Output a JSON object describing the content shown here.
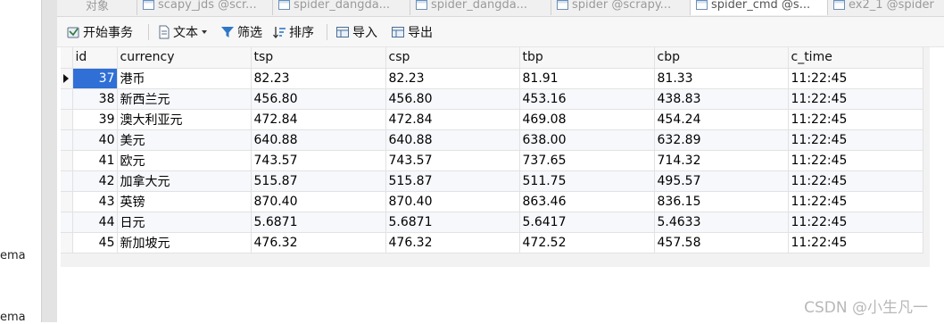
{
  "sidebar": {
    "fragments": [
      "ema",
      "ema"
    ]
  },
  "tabs": [
    {
      "label": "对象",
      "active": false
    },
    {
      "label": "scapy_jds @scr...",
      "active": false
    },
    {
      "label": "spider_dangda...",
      "active": false
    },
    {
      "label": "spider_dangda...",
      "active": false
    },
    {
      "label": "spider @scrapy...",
      "active": false
    },
    {
      "label": "spider_cmd @s...",
      "active": true
    },
    {
      "label": "ex2_1 @spider",
      "active": false
    }
  ],
  "toolbar": {
    "begin_transaction": "开始事务",
    "text": "文本",
    "filter": "筛选",
    "sort": "排序",
    "import": "导入",
    "export": "导出"
  },
  "grid": {
    "columns": [
      "id",
      "currency",
      "tsp",
      "csp",
      "tbp",
      "cbp",
      "c_time"
    ],
    "rows": [
      [
        "37",
        "港币",
        "82.23",
        "82.23",
        "81.91",
        "81.33",
        "11:22:45"
      ],
      [
        "38",
        "新西兰元",
        "456.80",
        "456.80",
        "453.16",
        "438.83",
        "11:22:45"
      ],
      [
        "39",
        "澳大利亚元",
        "472.84",
        "472.84",
        "469.08",
        "454.24",
        "11:22:45"
      ],
      [
        "40",
        "美元",
        "640.88",
        "640.88",
        "638.00",
        "632.89",
        "11:22:45"
      ],
      [
        "41",
        "欧元",
        "743.57",
        "743.57",
        "737.65",
        "714.32",
        "11:22:45"
      ],
      [
        "42",
        "加拿大元",
        "515.87",
        "515.87",
        "511.75",
        "495.57",
        "11:22:45"
      ],
      [
        "43",
        "英镑",
        "870.40",
        "870.40",
        "863.46",
        "836.15",
        "11:22:45"
      ],
      [
        "44",
        "日元",
        "5.6871",
        "5.6871",
        "5.6417",
        "5.4633",
        "11:22:45"
      ],
      [
        "45",
        "新加坡元",
        "476.32",
        "476.32",
        "472.52",
        "457.58",
        "11:22:45"
      ]
    ],
    "selected_row": 0
  },
  "watermark": "CSDN @小生凡一",
  "colors": {
    "selection": "#2f6fd6",
    "toolbar_bg": "#f7f7f7",
    "grid_border": "#e2e2e2"
  }
}
